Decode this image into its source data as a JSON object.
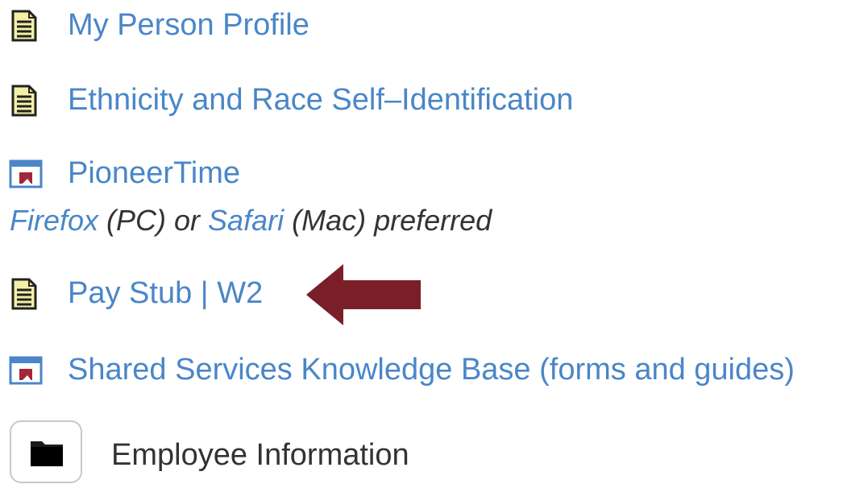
{
  "links": [
    {
      "label": "My Person Profile",
      "icon": "document-icon"
    },
    {
      "label": "Ethnicity and Race Self–Identification",
      "icon": "document-icon"
    },
    {
      "label": "PioneerTime",
      "icon": "window-icon"
    },
    {
      "label_a": "Pay Stub",
      "separator": " | ",
      "label_b": "W2",
      "icon": "document-icon"
    },
    {
      "label": "Shared Services Knowledge Base (forms and guides)",
      "icon": "window-icon"
    }
  ],
  "browser_note": {
    "firefox": "Firefox",
    "pc": " (PC) or ",
    "safari": "Safari",
    "mac": " (Mac) preferred"
  },
  "section": {
    "title": "Employee Information",
    "icon": "folder-icon"
  },
  "annotation": {
    "icon": "arrow-left-icon",
    "color": "#7a1f28"
  },
  "colors": {
    "link": "#4a86c8",
    "text": "#333333",
    "document_fill": "#f3f0a6",
    "window_accent": "#a3263b"
  }
}
